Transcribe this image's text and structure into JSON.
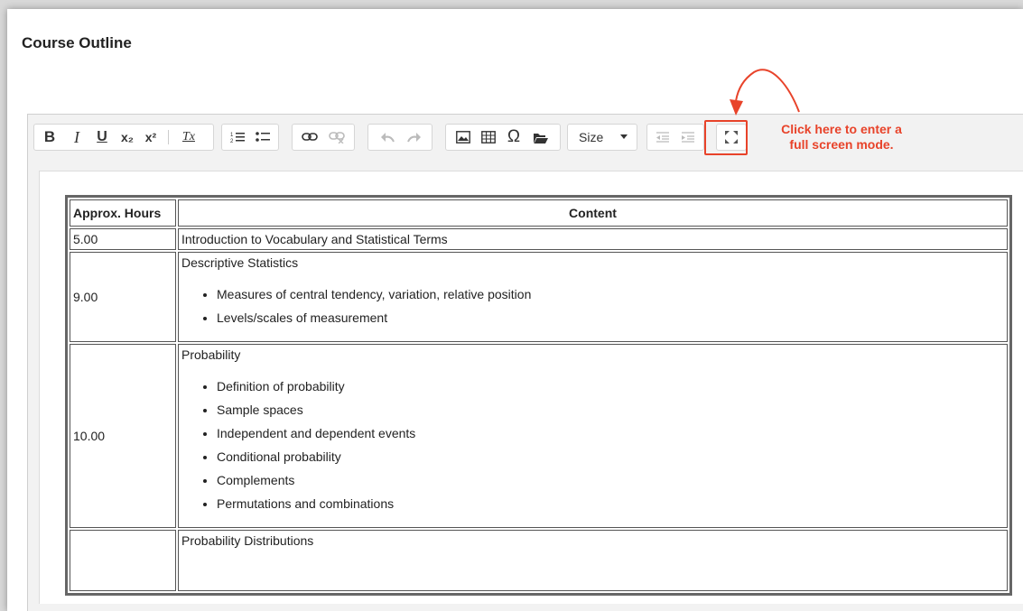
{
  "section_title": "Course Outline",
  "toolbar": {
    "bold": "B",
    "italic": "I",
    "underline": "U",
    "subscript": "x₂",
    "superscript": "x²",
    "remove_format": "Tx",
    "size_label": "Size"
  },
  "annotation": {
    "line1": "Click here to enter a",
    "line2": "full screen mode.",
    "color": "#e8432a"
  },
  "table": {
    "headers": [
      "Approx. Hours",
      "Content"
    ],
    "rows": [
      {
        "hours": "5.00",
        "title": "Introduction to Vocabulary and Statistical Terms",
        "bullets": []
      },
      {
        "hours": "9.00",
        "title": "Descriptive Statistics",
        "bullets": [
          "Measures of central tendency, variation, relative position",
          "Levels/scales of measurement"
        ]
      },
      {
        "hours": "10.00",
        "title": "Probability",
        "bullets": [
          "Definition of probability",
          "Sample spaces",
          "Independent and dependent events",
          "Conditional probability",
          "Complements",
          "Permutations and combinations"
        ]
      },
      {
        "hours": "",
        "title": "Probability Distributions",
        "bullets": []
      }
    ]
  }
}
